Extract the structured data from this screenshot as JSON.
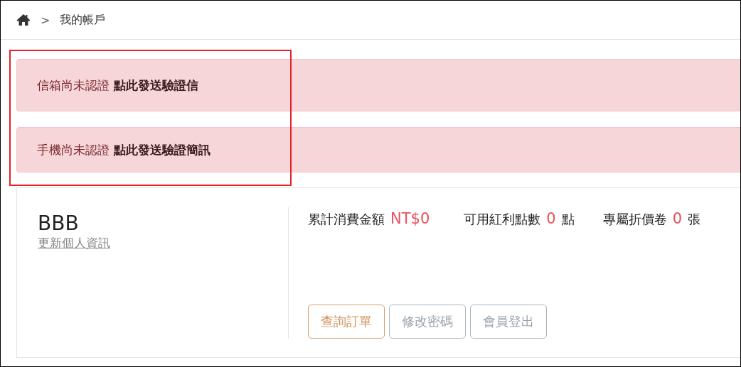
{
  "breadcrumb": {
    "items": [
      {
        "separator": ">",
        "label": "我的帳戶"
      }
    ]
  },
  "alerts": [
    {
      "text": "信箱尚未認證",
      "link": "點此發送驗證信"
    },
    {
      "text": "手機尚未認證",
      "link": "點此發送驗證簡訊"
    }
  ],
  "profile": {
    "name": "BBB",
    "edit_link": "更新個人資訊"
  },
  "stats": [
    {
      "label": "累計消費金額",
      "value": "NT$0"
    },
    {
      "label": "可用紅利點數",
      "value": "0",
      "unit": "點"
    },
    {
      "label": "專屬折價卷",
      "value": "0",
      "unit": "張"
    }
  ],
  "buttons": [
    {
      "label": "查詢訂單",
      "kind": "primary"
    },
    {
      "label": "修改密碼",
      "kind": "secondary"
    },
    {
      "label": "會員登出",
      "kind": "secondary"
    }
  ]
}
